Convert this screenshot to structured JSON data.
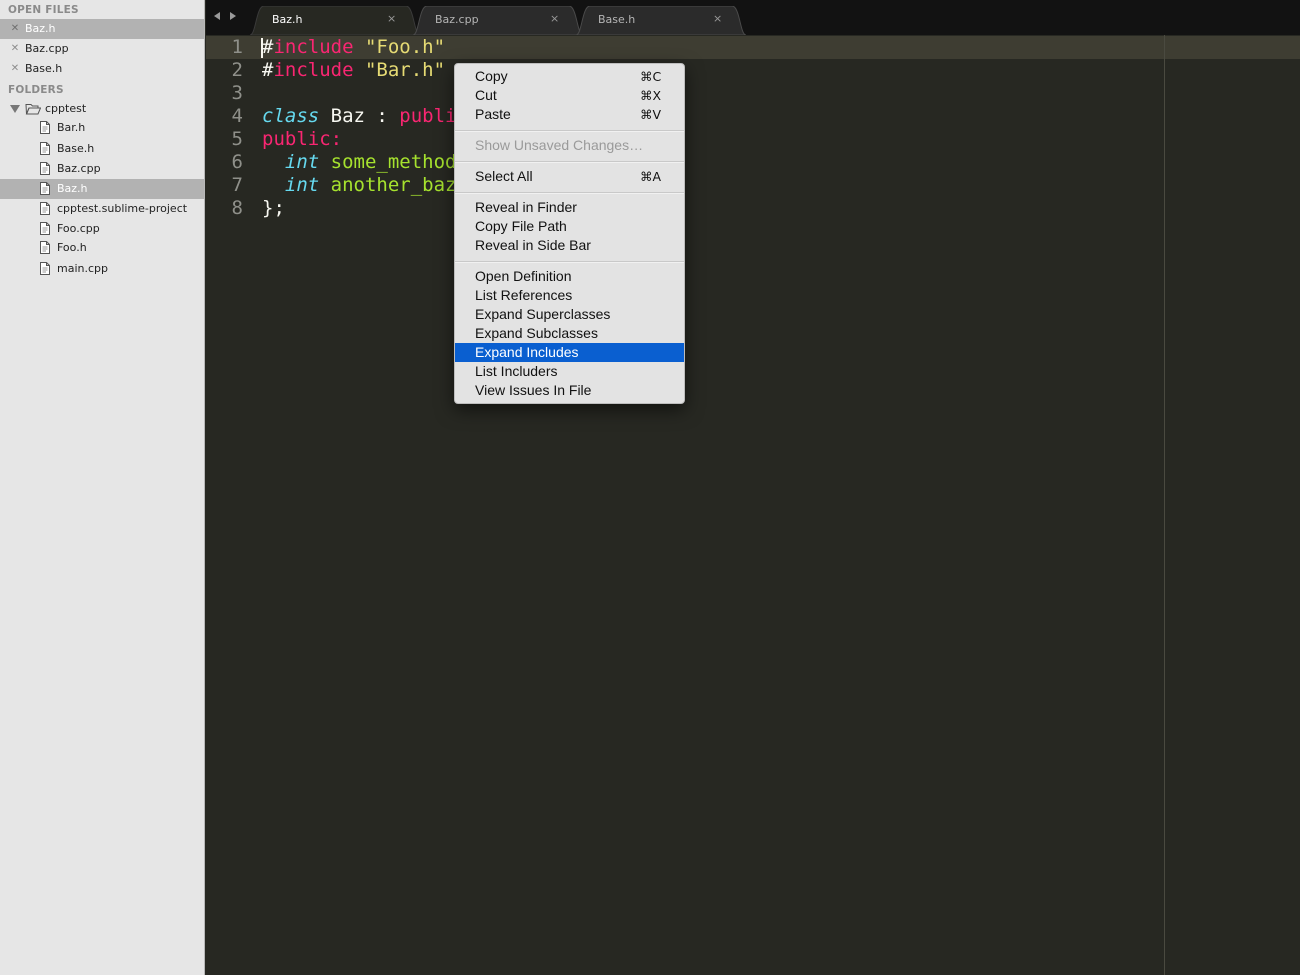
{
  "sidebar": {
    "open_files_heading": "OPEN FILES",
    "open_files": [
      {
        "label": "Baz.h",
        "selected": true
      },
      {
        "label": "Baz.cpp",
        "selected": false
      },
      {
        "label": "Base.h",
        "selected": false
      }
    ],
    "folders_heading": "FOLDERS",
    "folder": {
      "label": "cpptest",
      "expanded": true
    },
    "files": [
      {
        "label": "Bar.h",
        "selected": false
      },
      {
        "label": "Base.h",
        "selected": false
      },
      {
        "label": "Baz.cpp",
        "selected": false
      },
      {
        "label": "Baz.h",
        "selected": true
      },
      {
        "label": "cpptest.sublime-project",
        "selected": false
      },
      {
        "label": "Foo.cpp",
        "selected": false
      },
      {
        "label": "Foo.h",
        "selected": false
      },
      {
        "label": "main.cpp",
        "selected": false
      }
    ]
  },
  "tabs": [
    {
      "label": "Baz.h",
      "close": "×",
      "active": true
    },
    {
      "label": "Baz.cpp",
      "close": "×",
      "active": false
    },
    {
      "label": "Base.h",
      "close": "×",
      "active": false
    }
  ],
  "editor": {
    "line_numbers": [
      "1",
      "2",
      "3",
      "4",
      "5",
      "6",
      "7",
      "8"
    ],
    "lines": [
      [
        {
          "t": "#",
          "c": "plain"
        },
        {
          "t": "include",
          "c": "kw"
        },
        {
          "t": " ",
          "c": "plain"
        },
        {
          "t": "\"Foo.h\"",
          "c": "str"
        }
      ],
      [
        {
          "t": "#",
          "c": "plain"
        },
        {
          "t": "include",
          "c": "kw"
        },
        {
          "t": " ",
          "c": "plain"
        },
        {
          "t": "\"Bar.h\"",
          "c": "str"
        }
      ],
      [],
      [
        {
          "t": "class",
          "c": "type"
        },
        {
          "t": " Baz : ",
          "c": "plain"
        },
        {
          "t": "publi",
          "c": "kw"
        }
      ],
      [
        {
          "t": "public:",
          "c": "kw"
        }
      ],
      [
        {
          "t": "  ",
          "c": "plain"
        },
        {
          "t": "int",
          "c": "type"
        },
        {
          "t": " ",
          "c": "plain"
        },
        {
          "t": "some_method",
          "c": "fn"
        }
      ],
      [
        {
          "t": "  ",
          "c": "plain"
        },
        {
          "t": "int",
          "c": "type"
        },
        {
          "t": " ",
          "c": "plain"
        },
        {
          "t": "another_baz",
          "c": "fn"
        }
      ],
      [
        {
          "t": "};",
          "c": "plain"
        }
      ]
    ]
  },
  "context_menu": {
    "copy": {
      "label": "Copy",
      "shortcut": "⌘C"
    },
    "cut": {
      "label": "Cut",
      "shortcut": "⌘X"
    },
    "paste": {
      "label": "Paste",
      "shortcut": "⌘V"
    },
    "show_unsaved": {
      "label": "Show Unsaved Changes…",
      "disabled": true
    },
    "select_all": {
      "label": "Select All",
      "shortcut": "⌘A"
    },
    "reveal_finder": {
      "label": "Reveal in Finder"
    },
    "copy_path": {
      "label": "Copy File Path"
    },
    "reveal_sidebar": {
      "label": "Reveal in Side Bar"
    },
    "open_definition": {
      "label": "Open Definition"
    },
    "list_references": {
      "label": "List References"
    },
    "expand_superclasses": {
      "label": "Expand Superclasses"
    },
    "expand_subclasses": {
      "label": "Expand Subclasses"
    },
    "expand_includes": {
      "label": "Expand Includes",
      "highlighted": true
    },
    "list_includers": {
      "label": "List Includers"
    },
    "view_issues": {
      "label": "View Issues In File"
    }
  },
  "colors": {
    "editor_bg": "#272822",
    "keyword": "#f92672",
    "string": "#e6db74",
    "type": "#66d9ef",
    "function": "#a6e22e",
    "menu_highlight": "#0a5fd0"
  }
}
